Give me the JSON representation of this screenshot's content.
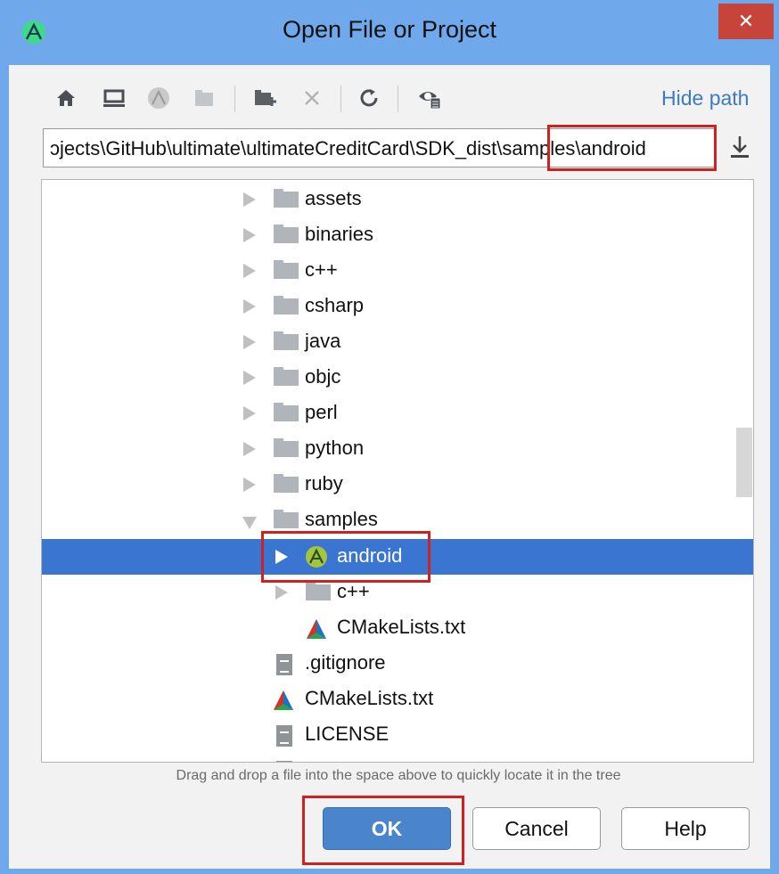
{
  "window": {
    "title": "Open File or Project",
    "close_label": "✕"
  },
  "toolbar": {
    "hide_path_label": "Hide path",
    "buttons": [
      {
        "icon": "home-icon"
      },
      {
        "icon": "desktop-icon"
      },
      {
        "icon": "android-project-icon"
      },
      {
        "icon": "module-icon"
      },
      {
        "icon": "new-folder-icon"
      },
      {
        "icon": "delete-icon"
      },
      {
        "icon": "refresh-icon"
      },
      {
        "icon": "show-hidden-icon"
      }
    ]
  },
  "path": {
    "value": "ɔjects\\GitHub\\ultimate\\ultimateCreditCard\\SDK_dist\\samples\\android"
  },
  "tree": {
    "items": [
      {
        "label": "assets",
        "type": "folder",
        "expanded": false
      },
      {
        "label": "binaries",
        "type": "folder",
        "expanded": false
      },
      {
        "label": "c++",
        "type": "folder",
        "expanded": false
      },
      {
        "label": "csharp",
        "type": "folder",
        "expanded": false
      },
      {
        "label": "java",
        "type": "folder",
        "expanded": false
      },
      {
        "label": "objc",
        "type": "folder",
        "expanded": false
      },
      {
        "label": "perl",
        "type": "folder",
        "expanded": false
      },
      {
        "label": "python",
        "type": "folder",
        "expanded": false
      },
      {
        "label": "ruby",
        "type": "folder",
        "expanded": false
      },
      {
        "label": "samples",
        "type": "folder",
        "expanded": true
      },
      {
        "label": "android",
        "type": "android-project",
        "expanded": false,
        "selected": true
      },
      {
        "label": "c++",
        "type": "folder",
        "expanded": false
      },
      {
        "label": "CMakeLists.txt",
        "type": "cmake-file"
      },
      {
        "label": ".gitignore",
        "type": "text-file"
      },
      {
        "label": "CMakeLists.txt",
        "type": "cmake-file"
      },
      {
        "label": "LICENSE",
        "type": "text-file"
      }
    ]
  },
  "hint": "Drag and drop a file into the space above to quickly locate it in the tree",
  "buttons": {
    "ok": "OK",
    "cancel": "Cancel",
    "help": "Help"
  },
  "colors": {
    "title_bar": "#6fa9ec",
    "selection": "#3a76d1",
    "accent_link": "#3d7ac4",
    "highlight": "#d02020",
    "ok_button": "#4a85cc"
  }
}
